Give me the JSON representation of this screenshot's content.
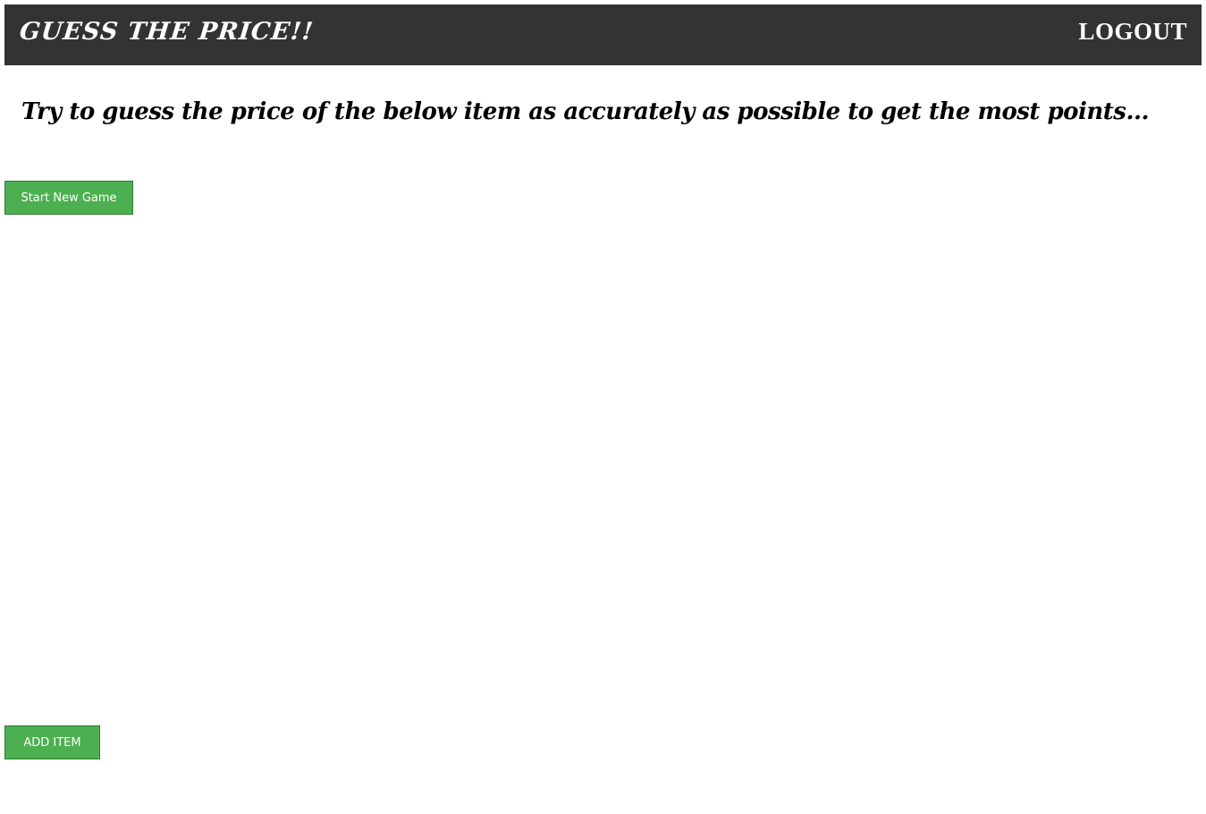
{
  "header": {
    "brand": "GUESS THE PRICE!!",
    "logout_label": "LOGOUT"
  },
  "main": {
    "instructions": "Try to guess the price of the below item as accurately as possible to get the most points...",
    "start_button_label": "Start New Game",
    "add_item_button_label": "ADD ITEM"
  },
  "colors": {
    "header_bg": "#333333",
    "button_bg": "#4caf50",
    "button_border": "#2e7d32",
    "text_light": "#ffffff"
  }
}
